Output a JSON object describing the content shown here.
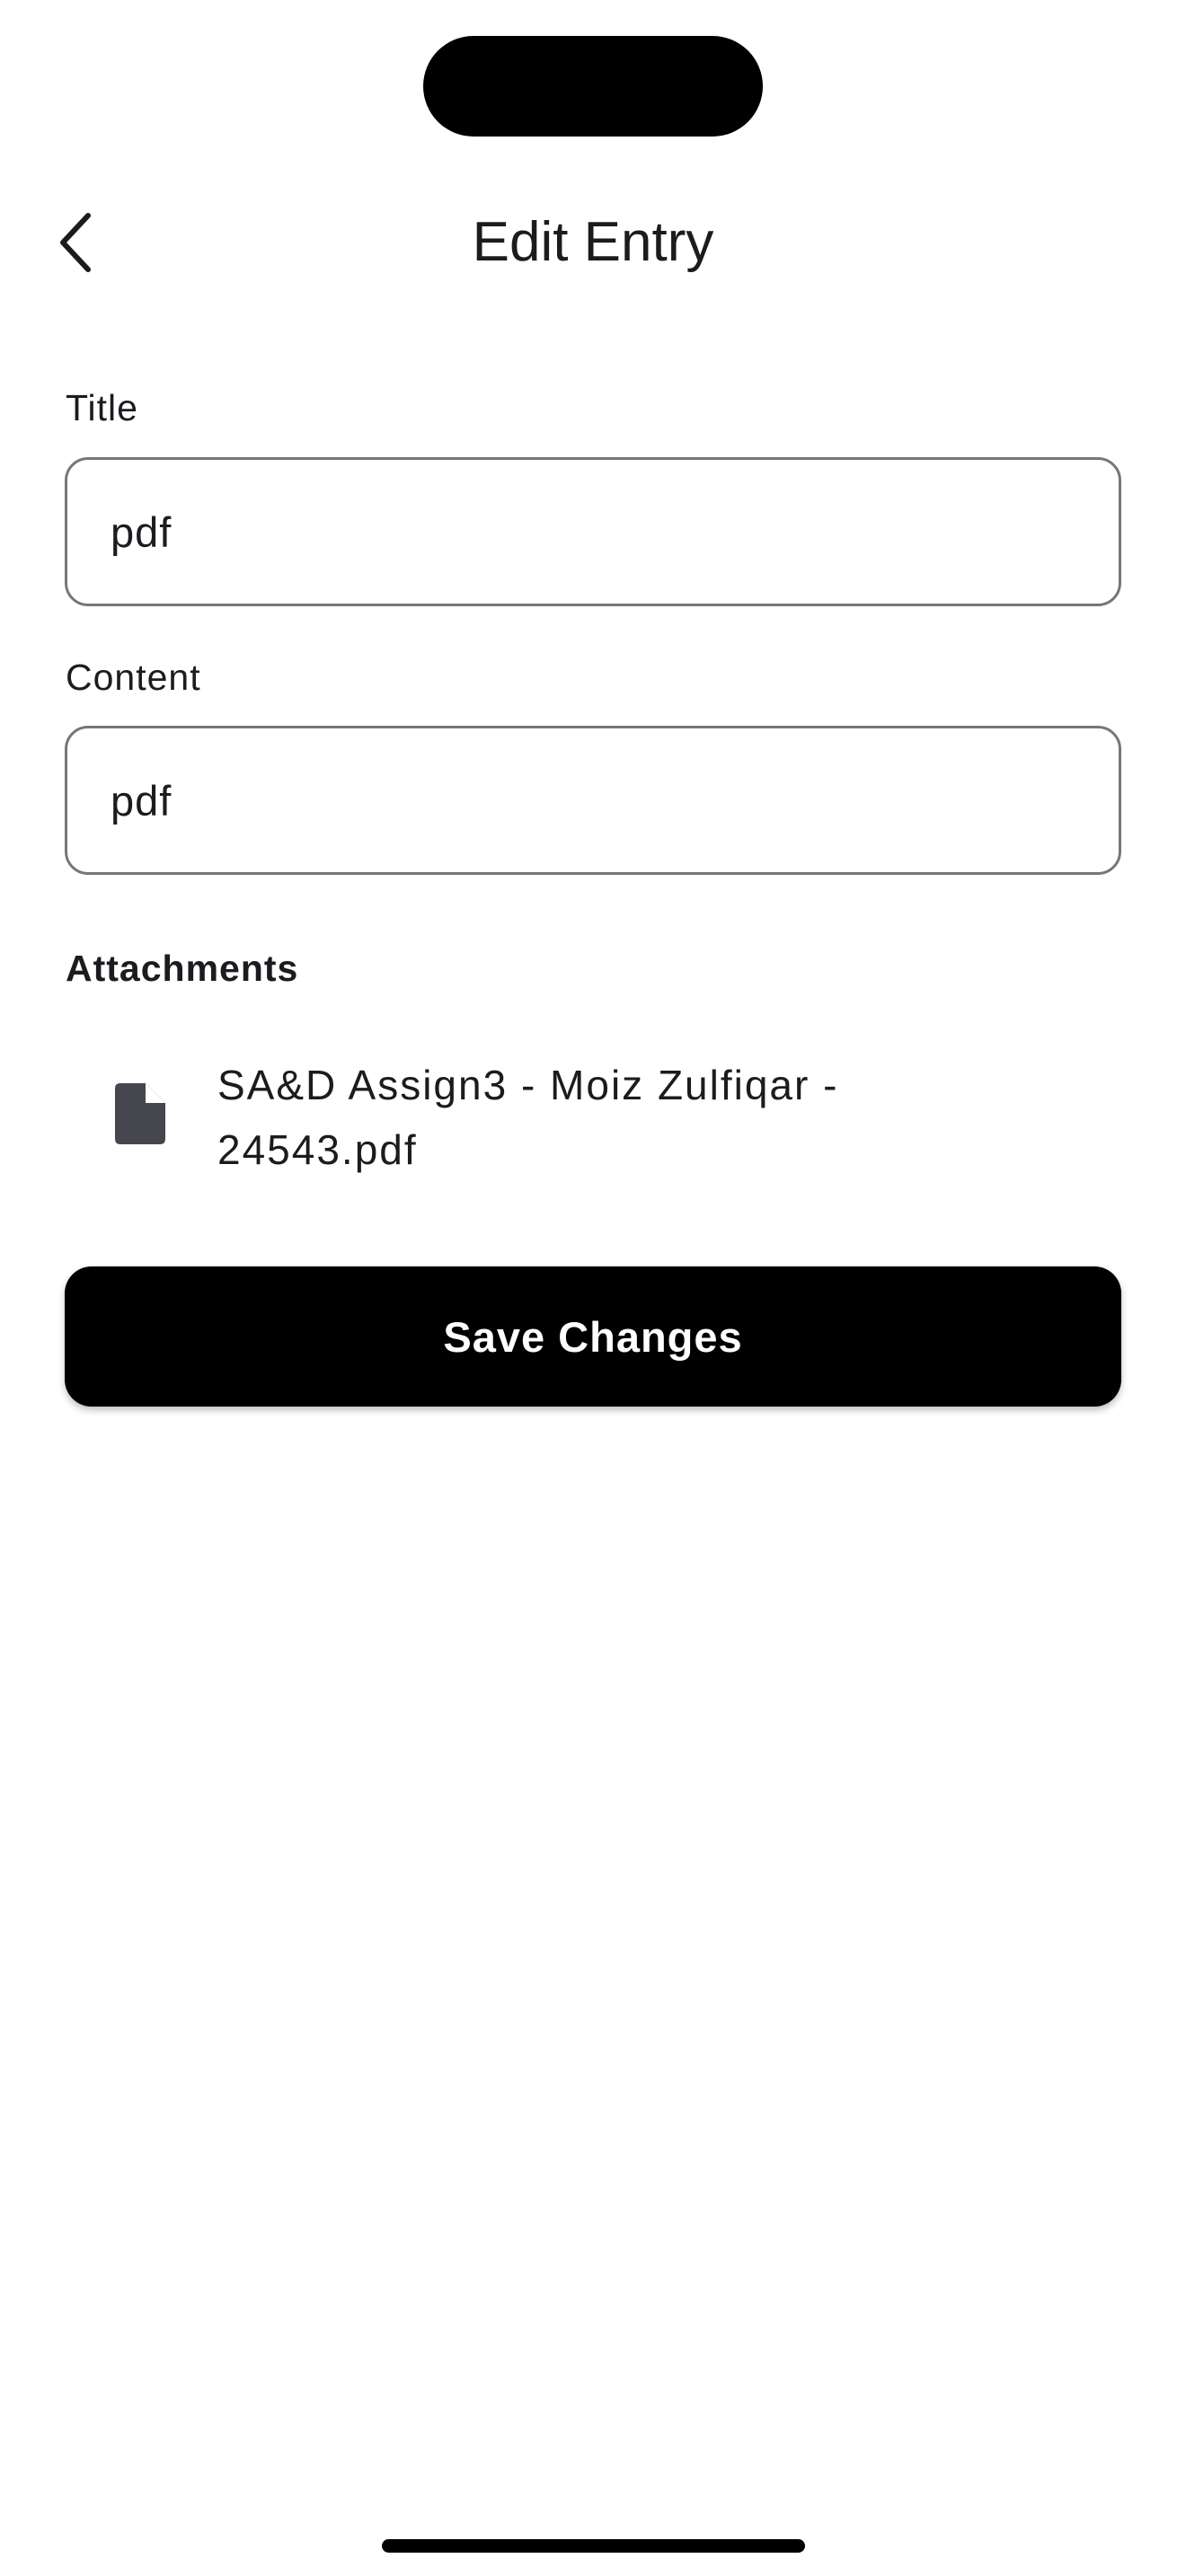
{
  "header": {
    "title": "Edit Entry",
    "back_icon": "chevron-left-icon"
  },
  "form": {
    "title_label": "Title",
    "title_value": "pdf",
    "content_label": "Content",
    "content_value": "pdf"
  },
  "attachments": {
    "heading": "Attachments",
    "items": [
      {
        "name": "SA&D Assign3 - Moiz Zulfiqar - 24543.pdf",
        "icon": "file-icon"
      }
    ]
  },
  "actions": {
    "save_label": "Save Changes"
  },
  "colors": {
    "primary": "#000000",
    "text": "#1c1b1f",
    "border": "#79747e",
    "icon": "#46464f"
  }
}
